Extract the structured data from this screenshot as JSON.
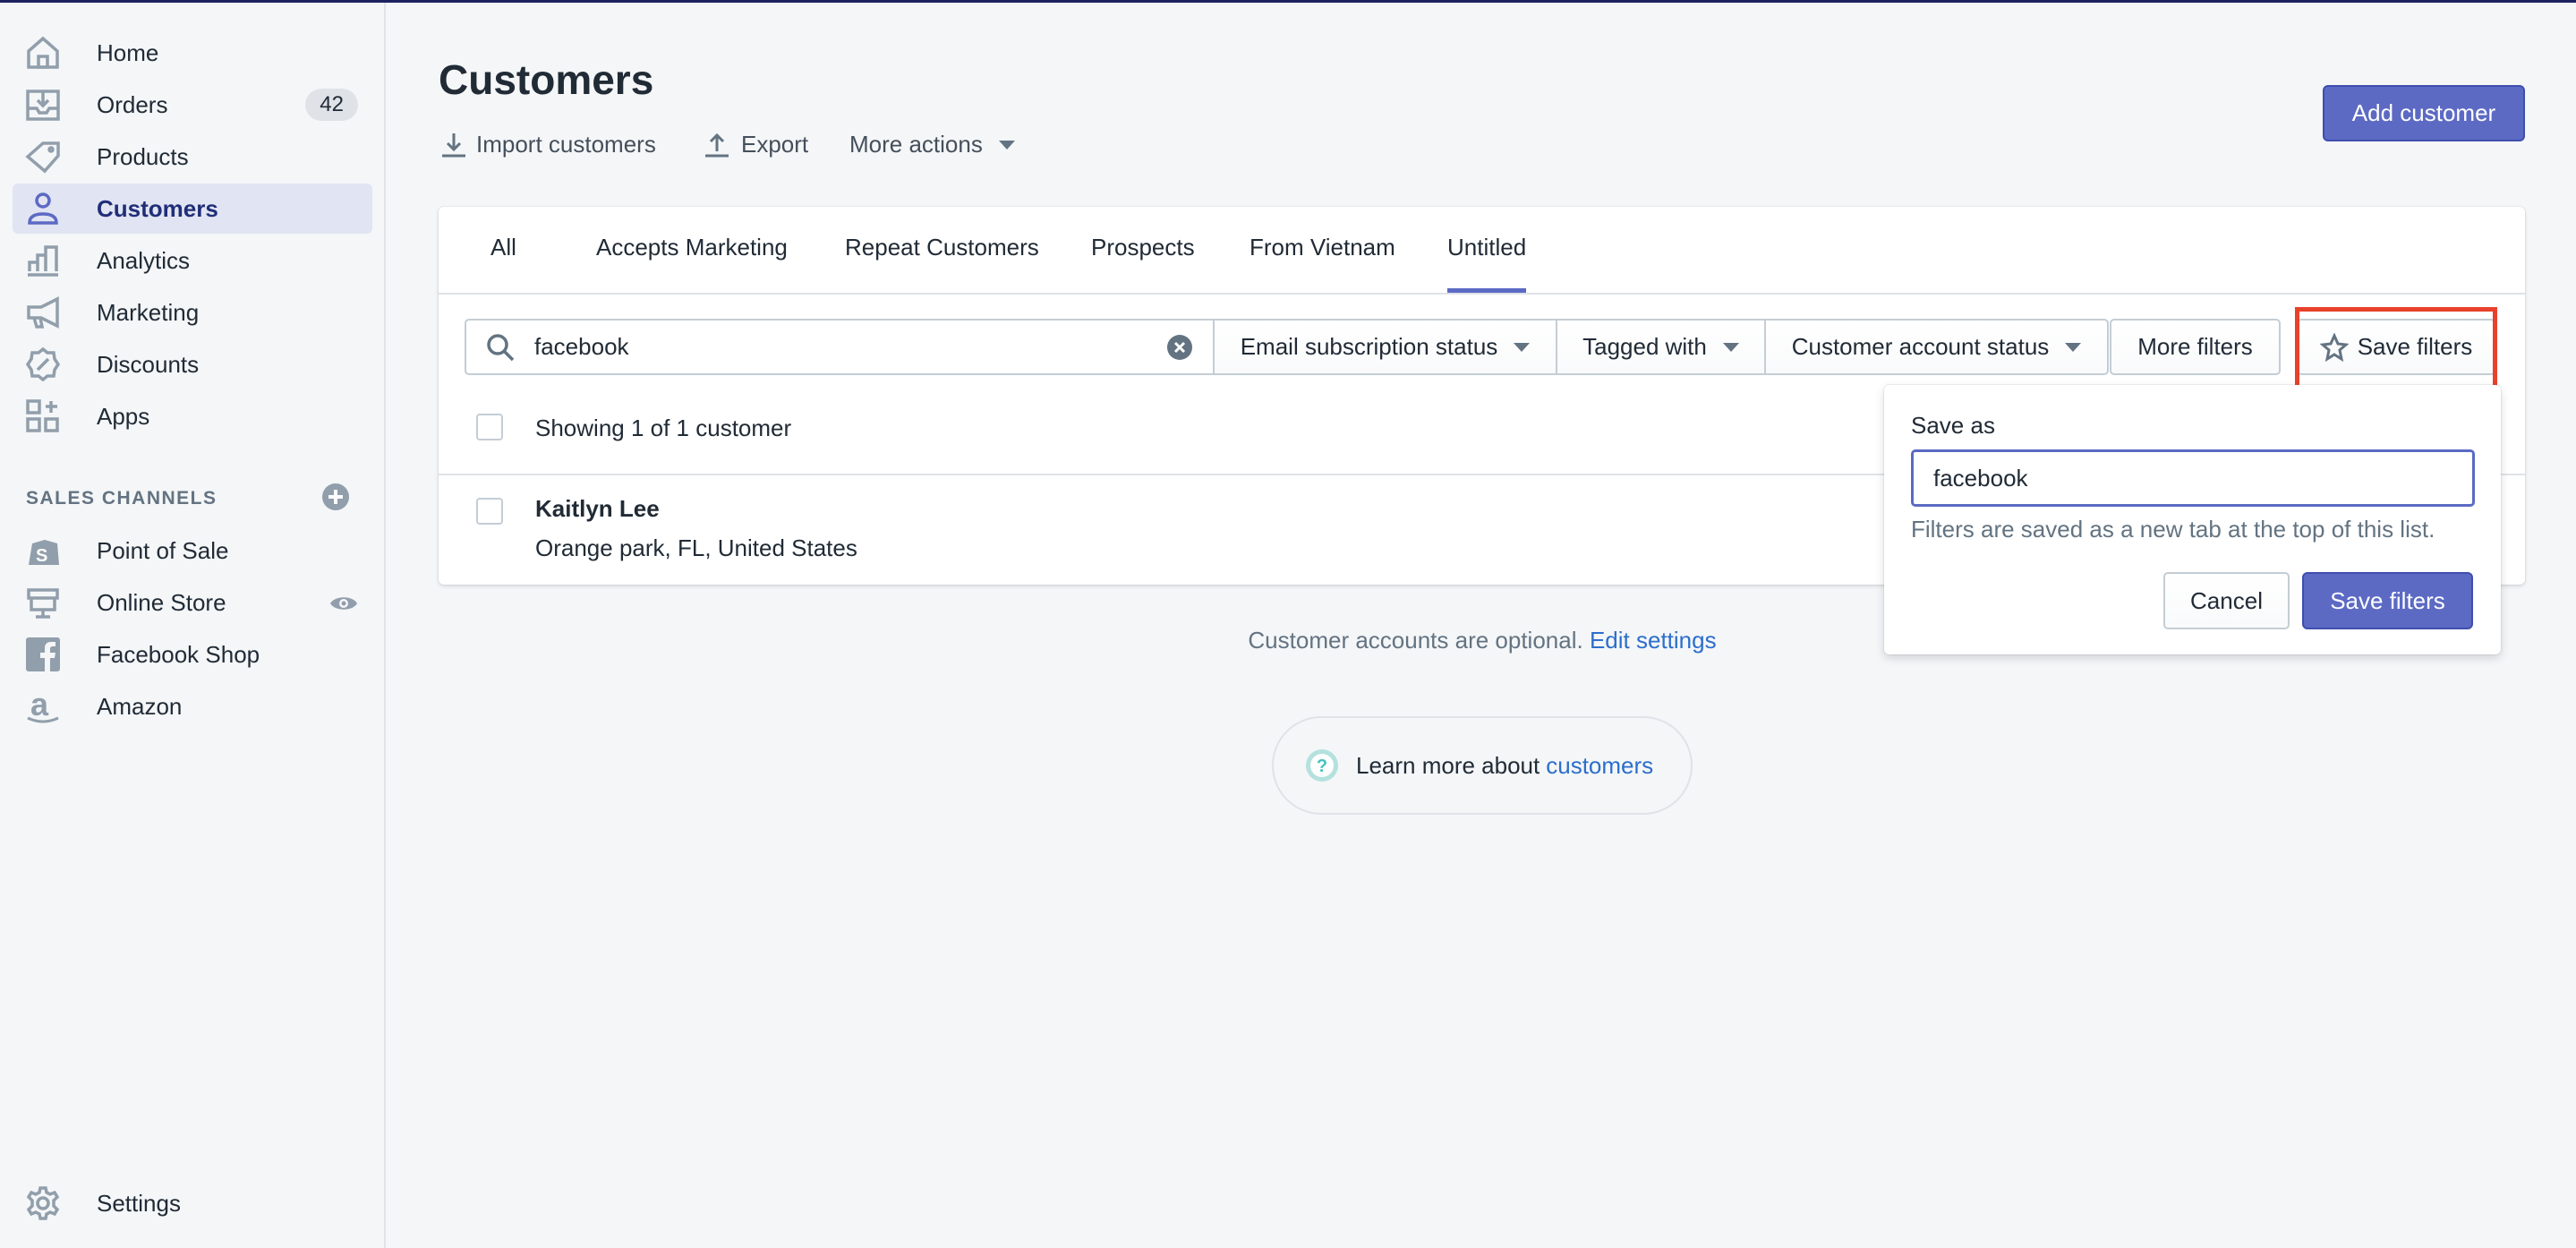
{
  "sidebar": {
    "items": [
      {
        "label": "Home",
        "icon": "home-icon"
      },
      {
        "label": "Orders",
        "icon": "orders-icon",
        "badge": "42"
      },
      {
        "label": "Products",
        "icon": "tag-icon"
      },
      {
        "label": "Customers",
        "icon": "person-icon",
        "active": true
      },
      {
        "label": "Analytics",
        "icon": "bar-chart-icon"
      },
      {
        "label": "Marketing",
        "icon": "megaphone-icon"
      },
      {
        "label": "Discounts",
        "icon": "discount-icon"
      },
      {
        "label": "Apps",
        "icon": "apps-icon"
      }
    ],
    "sales_channels_heading": "SALES CHANNELS",
    "channels": [
      {
        "label": "Point of Sale",
        "icon": "shopify-bag-icon"
      },
      {
        "label": "Online Store",
        "icon": "store-icon"
      },
      {
        "label": "Facebook Shop",
        "icon": "facebook-icon"
      },
      {
        "label": "Amazon",
        "icon": "amazon-icon"
      }
    ],
    "settings": "Settings"
  },
  "header": {
    "title": "Customers",
    "import": "Import customers",
    "export": "Export",
    "more_actions": "More actions",
    "add_customer": "Add customer"
  },
  "tabs": [
    "All",
    "Accepts Marketing",
    "Repeat Customers",
    "Prospects",
    "From Vietnam",
    "Untitled"
  ],
  "filters": {
    "search_value": "facebook",
    "email": "Email subscription status",
    "tagged": "Tagged with",
    "account": "Customer account status",
    "more": "More filters",
    "save": "Save filters"
  },
  "list": {
    "showing": "Showing 1 of 1 customer",
    "customers": [
      {
        "name": "Kaitlyn Lee",
        "location": "Orange park, FL, United States"
      }
    ]
  },
  "popover": {
    "label": "Save as",
    "value": "facebook",
    "help": "Filters are saved as a new tab at the top of this list.",
    "cancel": "Cancel",
    "save": "Save filters"
  },
  "footer": {
    "text": "Customer accounts are optional.",
    "link": "Edit settings",
    "learn": "Learn more about",
    "learn_link": "customers"
  },
  "colors": {
    "accent": "#5c6ac4",
    "link": "#2c6ecb",
    "highlight": "#e8412c"
  }
}
